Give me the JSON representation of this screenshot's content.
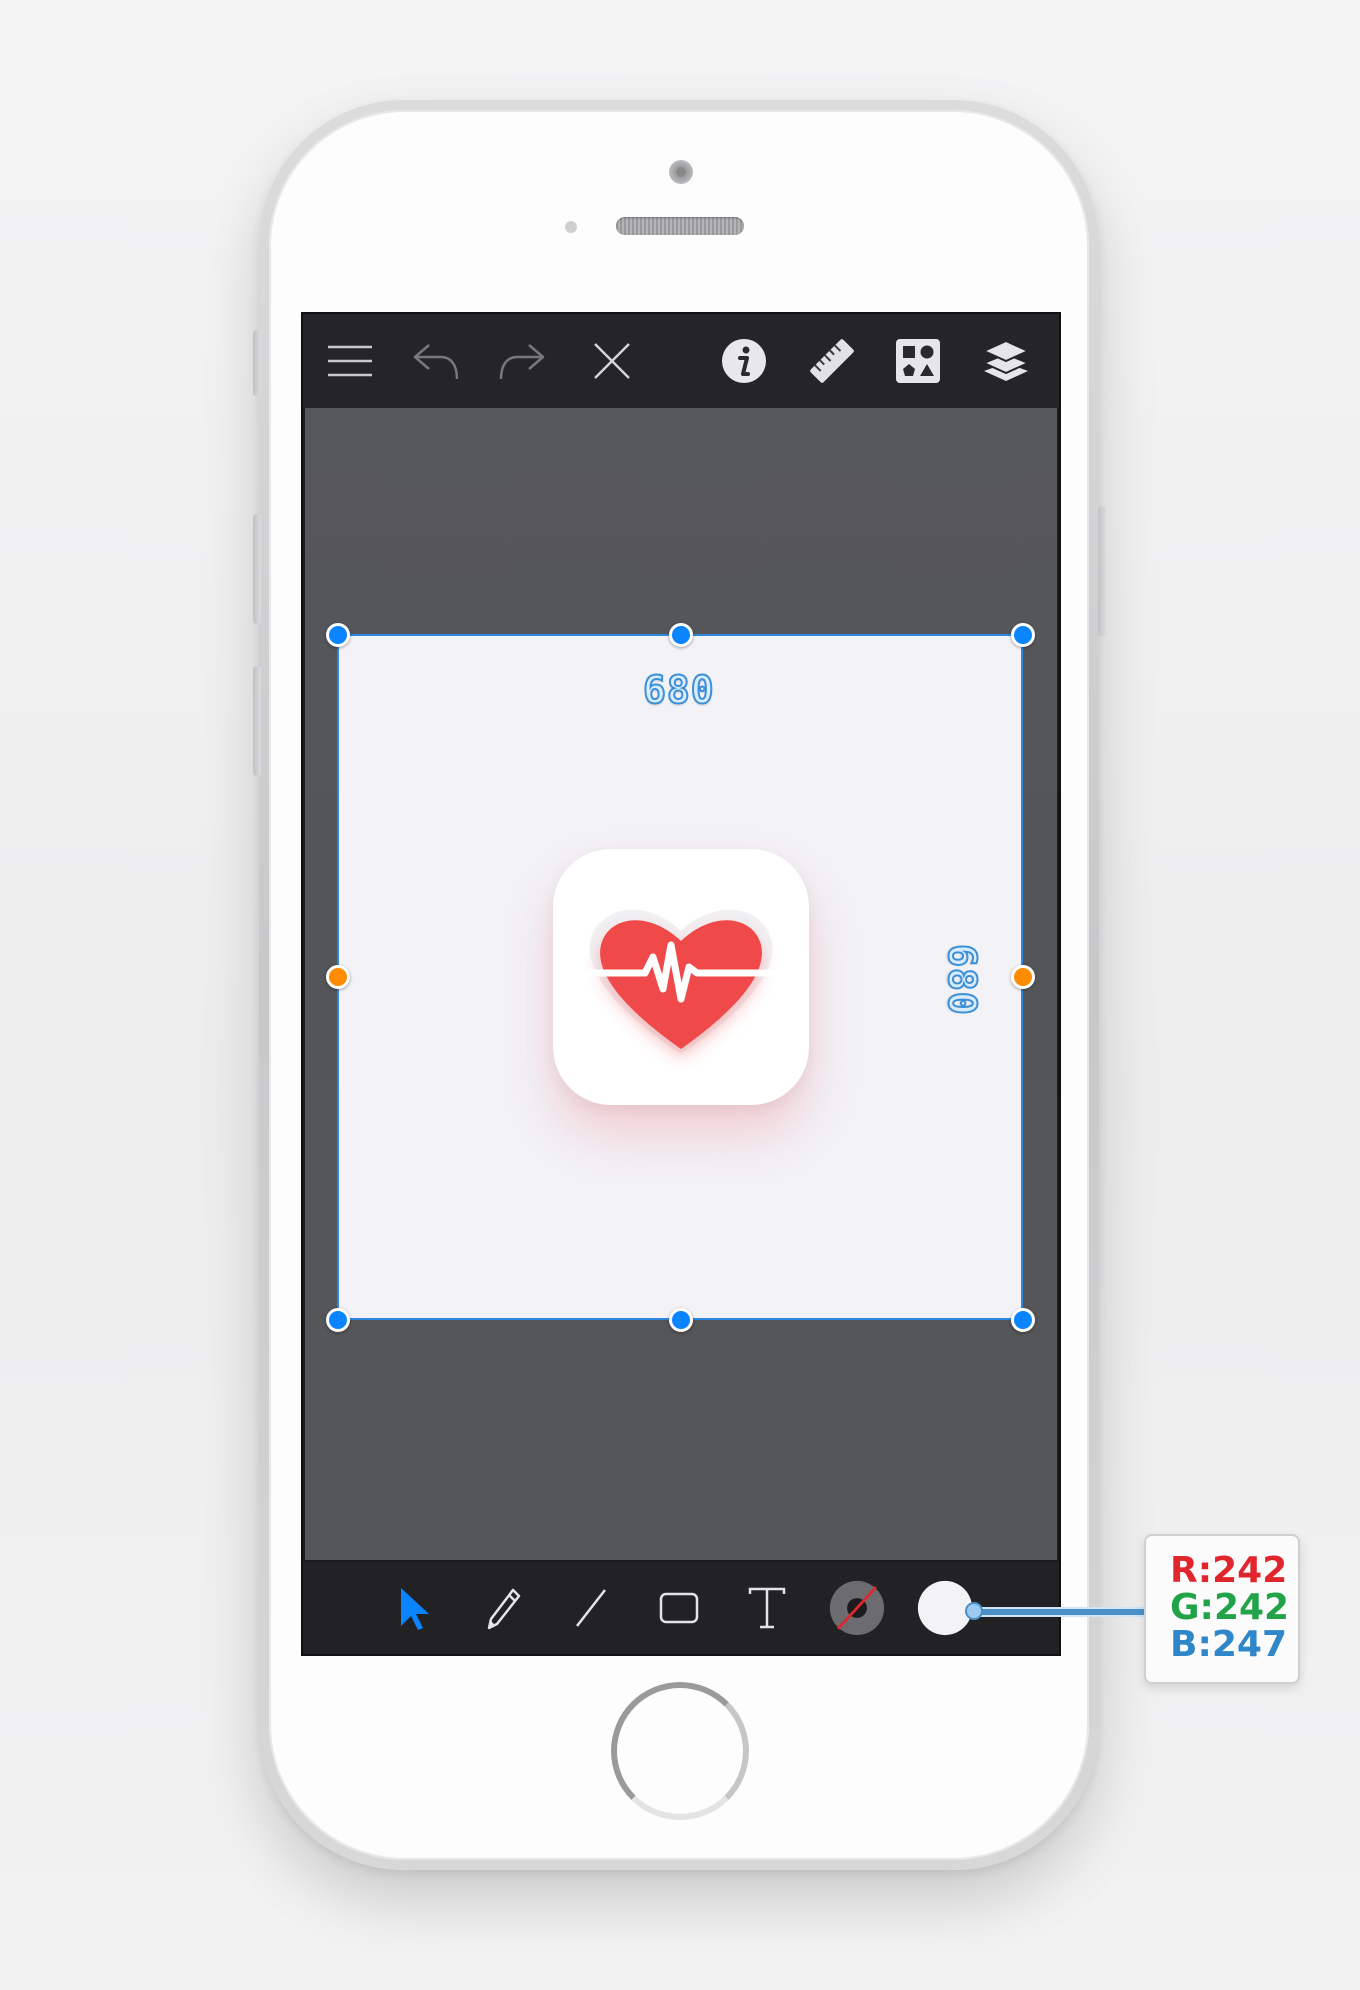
{
  "toolbar": {
    "menu_icon": "hamburger-menu-icon",
    "undo_icon": "undo-icon",
    "redo_icon": "redo-icon",
    "close_icon": "close-icon",
    "info_icon": "info-icon",
    "ruler_icon": "ruler-icon",
    "shapes_icon": "shapes-library-icon",
    "layers_icon": "layers-icon"
  },
  "artboard": {
    "width_label": "680",
    "height_label": "680",
    "fill_color": "#f2f2f7",
    "selection_color": "#2e86de"
  },
  "app_icon": {
    "name": "heart-pulse-icon",
    "heart_color": "#f04848",
    "background": "#ffffff"
  },
  "tools": {
    "select": "select-arrow-icon",
    "pencil": "pencil-icon",
    "line": "line-icon",
    "rectangle": "rectangle-icon",
    "text": "text-tool-icon",
    "stroke": "stroke-color-icon",
    "fill": "fill-color-swatch",
    "active_color": "#0a84ff"
  },
  "color_readout": {
    "r_label": "R:",
    "r_value": "242",
    "g_label": "G:",
    "g_value": "242",
    "b_label": "B:",
    "b_value": "247",
    "r_color": "#e0262c",
    "g_color": "#22a34a",
    "b_color": "#2f86c8"
  }
}
